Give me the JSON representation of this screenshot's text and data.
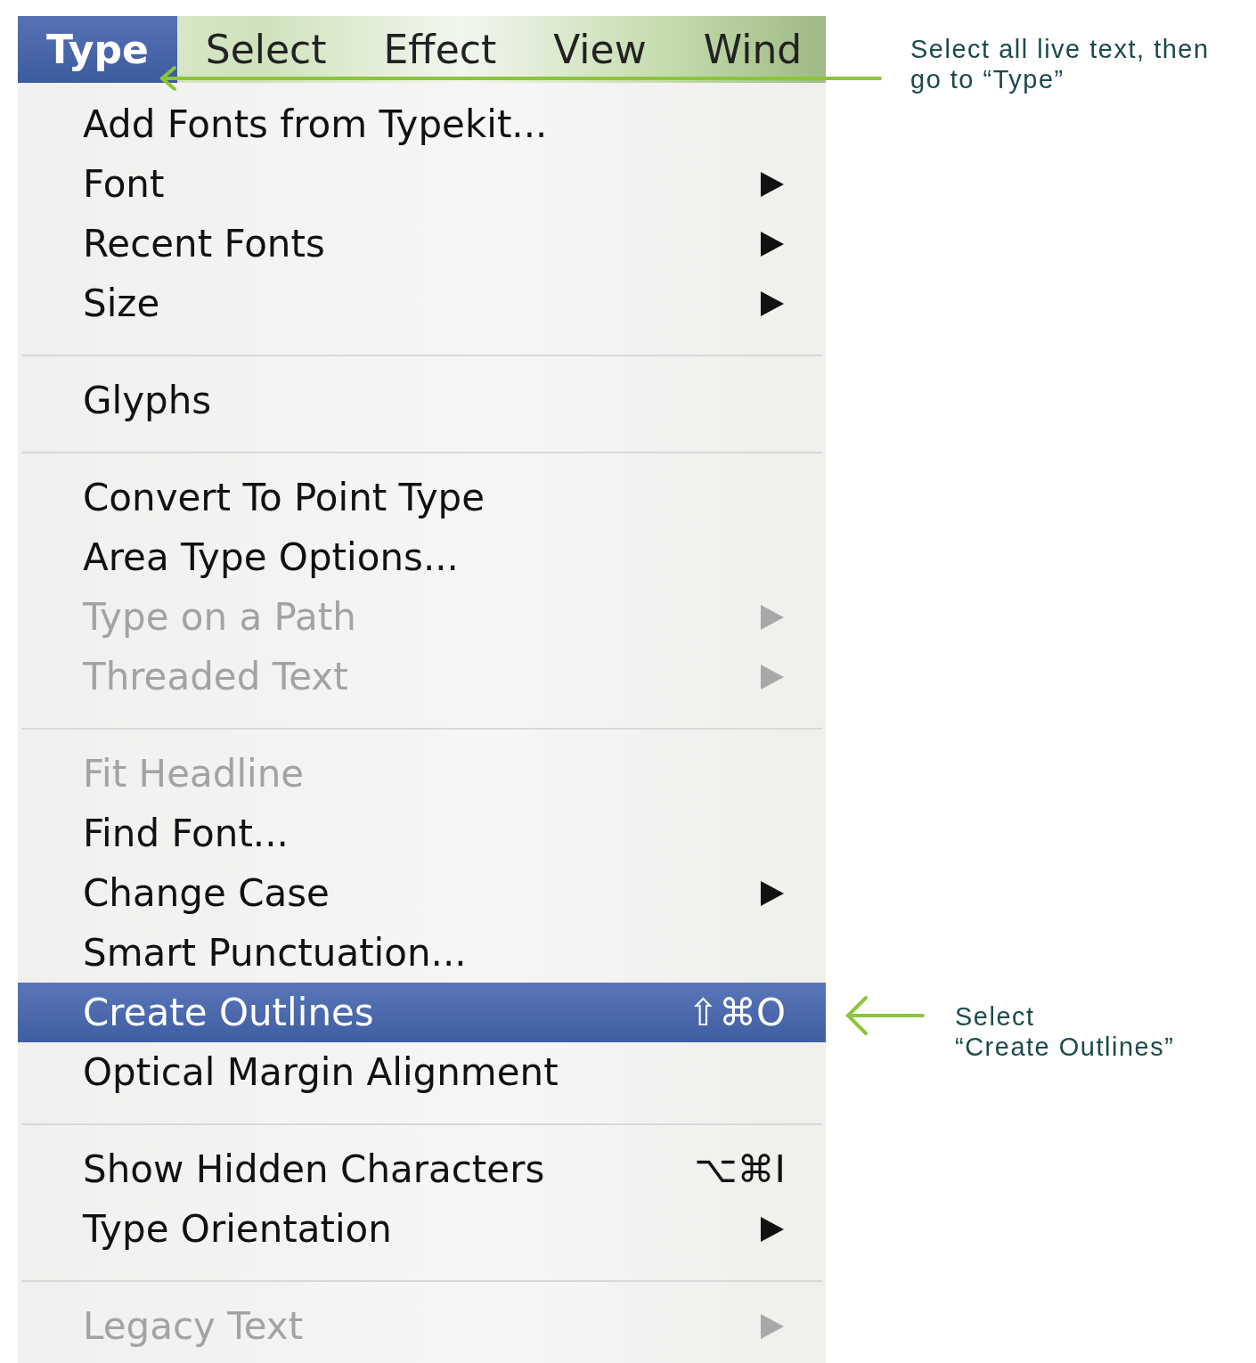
{
  "menu_bar": [
    {
      "label": "Type",
      "selected": true
    },
    {
      "label": "Select",
      "selected": false
    },
    {
      "label": "Effect",
      "selected": false
    },
    {
      "label": "View",
      "selected": false
    },
    {
      "label": "Wind",
      "selected": false
    }
  ],
  "menu": {
    "items": [
      {
        "kind": "item",
        "label": "Add Fonts from Typekit...",
        "submenu": false,
        "disabled": false,
        "selected": false
      },
      {
        "kind": "item",
        "label": "Font",
        "submenu": true,
        "disabled": false,
        "selected": false
      },
      {
        "kind": "item",
        "label": "Recent Fonts",
        "submenu": true,
        "disabled": false,
        "selected": false
      },
      {
        "kind": "item",
        "label": "Size",
        "submenu": true,
        "disabled": false,
        "selected": false
      },
      {
        "kind": "separator"
      },
      {
        "kind": "item",
        "label": "Glyphs",
        "submenu": false,
        "disabled": false,
        "selected": false
      },
      {
        "kind": "separator"
      },
      {
        "kind": "item",
        "label": "Convert To Point Type",
        "submenu": false,
        "disabled": false,
        "selected": false
      },
      {
        "kind": "item",
        "label": "Area Type Options...",
        "submenu": false,
        "disabled": false,
        "selected": false
      },
      {
        "kind": "item",
        "label": "Type on a Path",
        "submenu": true,
        "disabled": true,
        "selected": false
      },
      {
        "kind": "item",
        "label": "Threaded Text",
        "submenu": true,
        "disabled": true,
        "selected": false
      },
      {
        "kind": "separator"
      },
      {
        "kind": "item",
        "label": "Fit Headline",
        "submenu": false,
        "disabled": true,
        "selected": false
      },
      {
        "kind": "item",
        "label": "Find Font...",
        "submenu": false,
        "disabled": false,
        "selected": false
      },
      {
        "kind": "item",
        "label": "Change Case",
        "submenu": true,
        "disabled": false,
        "selected": false
      },
      {
        "kind": "item",
        "label": "Smart Punctuation...",
        "submenu": false,
        "disabled": false,
        "selected": false
      },
      {
        "kind": "item",
        "label": "Create Outlines",
        "shortcut": "⇧⌘O",
        "submenu": false,
        "disabled": false,
        "selected": true
      },
      {
        "kind": "item",
        "label": "Optical Margin Alignment",
        "submenu": false,
        "disabled": false,
        "selected": false
      },
      {
        "kind": "separator"
      },
      {
        "kind": "item",
        "label": "Show Hidden Characters",
        "shortcut": "⌥⌘I",
        "submenu": false,
        "disabled": false,
        "selected": false
      },
      {
        "kind": "item",
        "label": "Type Orientation",
        "submenu": true,
        "disabled": false,
        "selected": false
      },
      {
        "kind": "separator"
      },
      {
        "kind": "item",
        "label": "Legacy Text",
        "submenu": true,
        "disabled": true,
        "selected": false
      }
    ]
  },
  "annotations": [
    {
      "text": "Select all live text, then\ngo to “Type”"
    },
    {
      "text": "Select\n“Create Outlines”"
    }
  ]
}
